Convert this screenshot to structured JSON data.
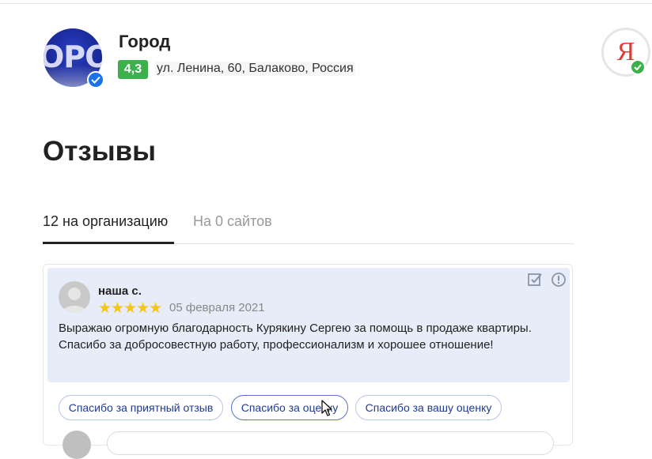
{
  "organization": {
    "name": "Город",
    "avatar_text": "ОРО",
    "rating": "4,3",
    "address": "ул. Ленина, 60, Балаково, Россия"
  },
  "yandex": {
    "logo_letter": "Я"
  },
  "page": {
    "title": "Отзывы"
  },
  "tabs": [
    {
      "label": "12 на организацию",
      "active": true
    },
    {
      "label": "На 0 сайтов",
      "active": false
    }
  ],
  "review": {
    "author": "наша с.",
    "stars": "★★★★★",
    "rating_value": 5,
    "date": "05 февраля 2021",
    "text": "Выражаю огромную благодарность Курякину Сергею за помощь в продаже квартиры. Спасибо за добросовестную работу, профессионализм и хорошее отношение!"
  },
  "reply_suggestions": [
    "Спасибо за приятный отзыв",
    "Спасибо за оценку",
    "Спасибо за вашу оценку"
  ],
  "icons": {
    "verified": "verified-check-icon",
    "edit": "edit-check-icon",
    "alert": "alert-icon",
    "cursor": "mouse-cursor-icon"
  },
  "colors": {
    "rating_badge": "#3cb04a",
    "verified": "#1a73e8",
    "review_background": "#e6ecf8",
    "stars": "#f5c518",
    "chip_text": "#1f3a93",
    "yandex_red": "#e53935"
  }
}
